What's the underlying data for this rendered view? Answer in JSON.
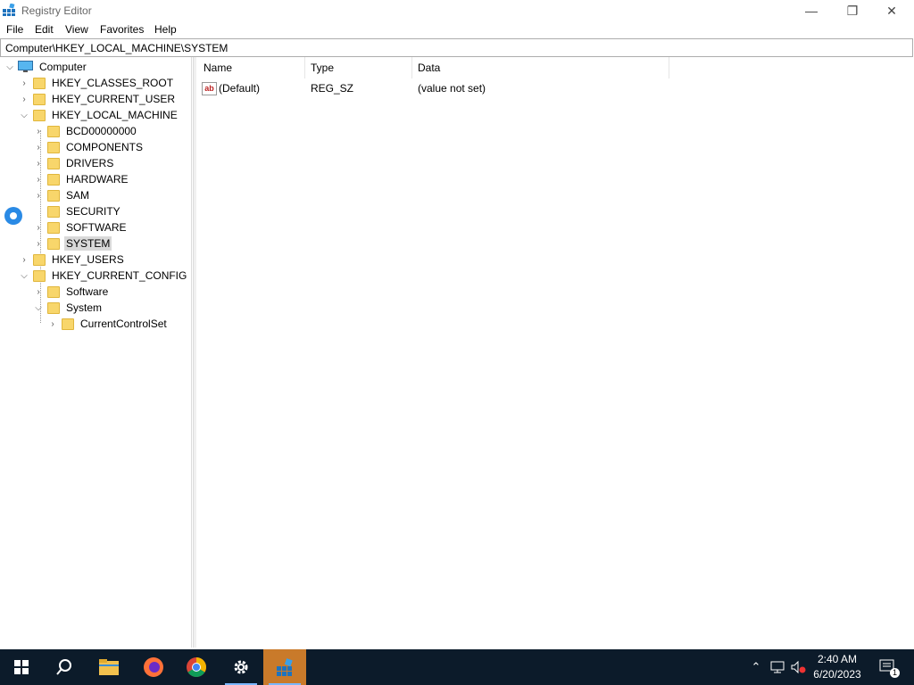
{
  "window": {
    "title": "Registry Editor",
    "controls": {
      "minimize": "—",
      "restore": "❐",
      "close": "✕"
    }
  },
  "menu": [
    "File",
    "Edit",
    "View",
    "Favorites",
    "Help"
  ],
  "address": "Computer\\HKEY_LOCAL_MACHINE\\SYSTEM",
  "tree": {
    "root": "Computer",
    "nodes": [
      {
        "label": "HKEY_CLASSES_ROOT",
        "expanded": false
      },
      {
        "label": "HKEY_CURRENT_USER",
        "expanded": false
      },
      {
        "label": "HKEY_LOCAL_MACHINE",
        "expanded": true
      },
      {
        "label": "BCD00000000",
        "expanded": false
      },
      {
        "label": "COMPONENTS",
        "expanded": false
      },
      {
        "label": "DRIVERS",
        "expanded": false
      },
      {
        "label": "HARDWARE",
        "expanded": false
      },
      {
        "label": "SAM",
        "expanded": false
      },
      {
        "label": "SECURITY",
        "expanded": false
      },
      {
        "label": "SOFTWARE",
        "expanded": false
      },
      {
        "label": "SYSTEM",
        "expanded": false,
        "selected": true
      },
      {
        "label": "HKEY_USERS",
        "expanded": false
      },
      {
        "label": "HKEY_CURRENT_CONFIG",
        "expanded": true
      },
      {
        "label": "Software",
        "expanded": false
      },
      {
        "label": "System",
        "expanded": true
      },
      {
        "label": "CurrentControlSet",
        "expanded": false
      }
    ]
  },
  "list": {
    "columns": [
      "Name",
      "Type",
      "Data"
    ],
    "rows": [
      {
        "name": "(Default)",
        "type": "REG_SZ",
        "data": "(value not set)"
      }
    ]
  },
  "taskbar": {
    "apps": [
      "start-icon",
      "search-icon",
      "file-explorer-icon",
      "firefox-icon",
      "chrome-icon",
      "settings-icon",
      "registry-editor-icon"
    ],
    "time": "2:40 AM",
    "date": "6/20/2023",
    "notification_count": "1"
  },
  "colors": {
    "taskbar": "#0c1b2a",
    "active_app": "#c97a2a",
    "folder": "#f8d66b",
    "selection": "#d9d9d9"
  }
}
